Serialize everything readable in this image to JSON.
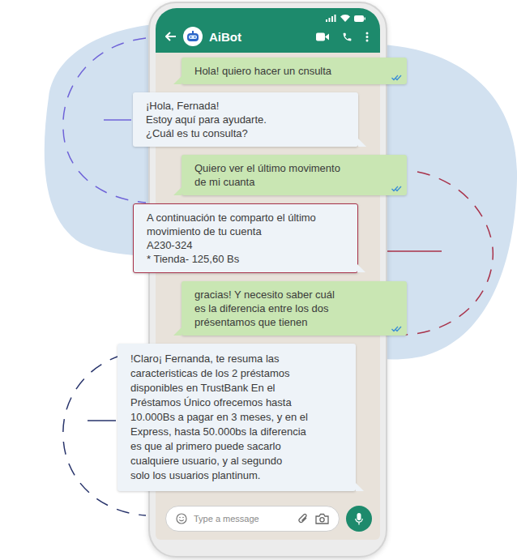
{
  "header": {
    "title": "AiBot"
  },
  "messages": [
    {
      "sender": "user",
      "read": true,
      "highlighted": false,
      "lines": [
        "Hola! quiero hacer un cnsulta"
      ]
    },
    {
      "sender": "bot",
      "read": false,
      "highlighted": false,
      "lines": [
        "¡Hola, Fernada!",
        "Estoy aquí para ayudarte.",
        "¿Cuál es tu consulta?"
      ]
    },
    {
      "sender": "user",
      "read": true,
      "highlighted": false,
      "lines": [
        "Quiero ver el último movimento",
        "de mi cuanta"
      ]
    },
    {
      "sender": "bot",
      "read": false,
      "highlighted": true,
      "lines": [
        "A continuación te comparto el último",
        "movimiento de tu cuenta",
        "A230-324",
        "* Tienda- 125,60 Bs"
      ]
    },
    {
      "sender": "user",
      "read": true,
      "highlighted": false,
      "lines": [
        "gracias! Y necesito saber cuál",
        "es la diferencia entre los dos",
        "présentamos que tienen"
      ]
    },
    {
      "sender": "bot",
      "read": false,
      "highlighted": false,
      "lines": [
        "!Claro¡ Fernanda, te resuma las",
        "caracteristicas de los 2 préstamos",
        "disponibles en TrustBank En el",
        "Préstamos Único ofrecemos hasta",
        "10.000Bs a pagar en 3 meses, y en el",
        "Express, hasta 50.000bs la diferencia",
        "es que al primero puede sacarlo",
        "cualquiere usuario, y al segundo",
        "solo los usuarios plantinum."
      ]
    }
  ],
  "input": {
    "placeholder": "Type a message"
  }
}
